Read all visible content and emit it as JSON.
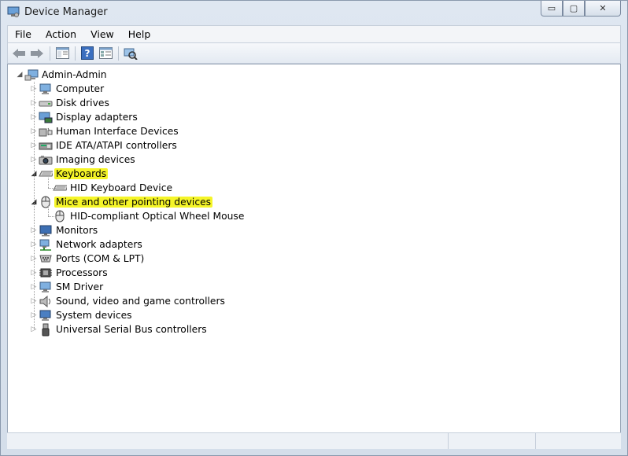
{
  "window": {
    "title": "Device Manager",
    "minimize_glyph": "▭",
    "maximize_glyph": "▢",
    "close_glyph": "✕"
  },
  "menu": [
    "File",
    "Action",
    "View",
    "Help"
  ],
  "toolbar": {
    "back_icon": "back-arrow-icon",
    "forward_icon": "forward-arrow-icon",
    "properties_icon": "properties-icon",
    "help_icon": "help-icon",
    "view_icon": "view-icon",
    "scan_icon": "scan-hardware-icon"
  },
  "tree": {
    "root": "Admin-Admin",
    "nodes": [
      {
        "label": "Computer",
        "icon": "computer-icon",
        "expanded": false
      },
      {
        "label": "Disk drives",
        "icon": "disk-drive-icon",
        "expanded": false
      },
      {
        "label": "Display adapters",
        "icon": "display-adapter-icon",
        "expanded": false
      },
      {
        "label": "Human Interface Devices",
        "icon": "hid-icon",
        "expanded": false
      },
      {
        "label": "IDE ATA/ATAPI controllers",
        "icon": "ide-controller-icon",
        "expanded": false
      },
      {
        "label": "Imaging devices",
        "icon": "camera-icon",
        "expanded": false
      },
      {
        "label": "Keyboards",
        "icon": "keyboard-icon",
        "expanded": true,
        "highlighted": true
      },
      {
        "label": "HID Keyboard Device",
        "icon": "keyboard-icon",
        "child": true
      },
      {
        "label": "Mice and other pointing devices",
        "icon": "mouse-icon",
        "expanded": true,
        "highlighted": true
      },
      {
        "label": "HID-compliant Optical Wheel Mouse",
        "icon": "mouse-icon",
        "child": true
      },
      {
        "label": "Monitors",
        "icon": "monitor-icon",
        "expanded": false
      },
      {
        "label": "Network adapters",
        "icon": "network-adapter-icon",
        "expanded": false
      },
      {
        "label": "Ports (COM & LPT)",
        "icon": "port-icon",
        "expanded": false
      },
      {
        "label": "Processors",
        "icon": "processor-icon",
        "expanded": false
      },
      {
        "label": "SM Driver",
        "icon": "driver-icon",
        "expanded": false
      },
      {
        "label": "Sound, video and game controllers",
        "icon": "speaker-icon",
        "expanded": false
      },
      {
        "label": "System devices",
        "icon": "system-device-icon",
        "expanded": false
      },
      {
        "label": "Universal Serial Bus controllers",
        "icon": "usb-icon",
        "expanded": false
      }
    ]
  },
  "colors": {
    "highlight": "#f5f528",
    "chrome": "#dfe7f1"
  }
}
